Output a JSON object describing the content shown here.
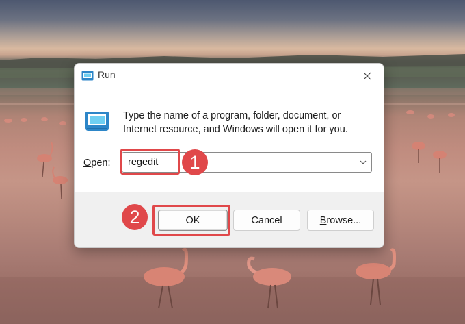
{
  "window": {
    "title": "Run",
    "close_icon": "close-icon",
    "app_icon": "run-app-icon"
  },
  "description": {
    "line1": "Type the name of a program, folder, document, or",
    "line2": "Internet resource, and Windows will open it for you."
  },
  "open_field": {
    "label_accel": "O",
    "label_rest": "pen:",
    "value": "regedit"
  },
  "buttons": {
    "ok": "OK",
    "cancel": "Cancel",
    "browse_accel": "B",
    "browse_rest": "rowse..."
  },
  "annotations": {
    "step1": "1",
    "step2": "2",
    "color": "#e0484a"
  },
  "colors": {
    "dialog_bg": "#ffffff",
    "footer_bg": "#f0f0f0",
    "icon_blue": "#2d86c8",
    "icon_cyan": "#6fcff2"
  }
}
